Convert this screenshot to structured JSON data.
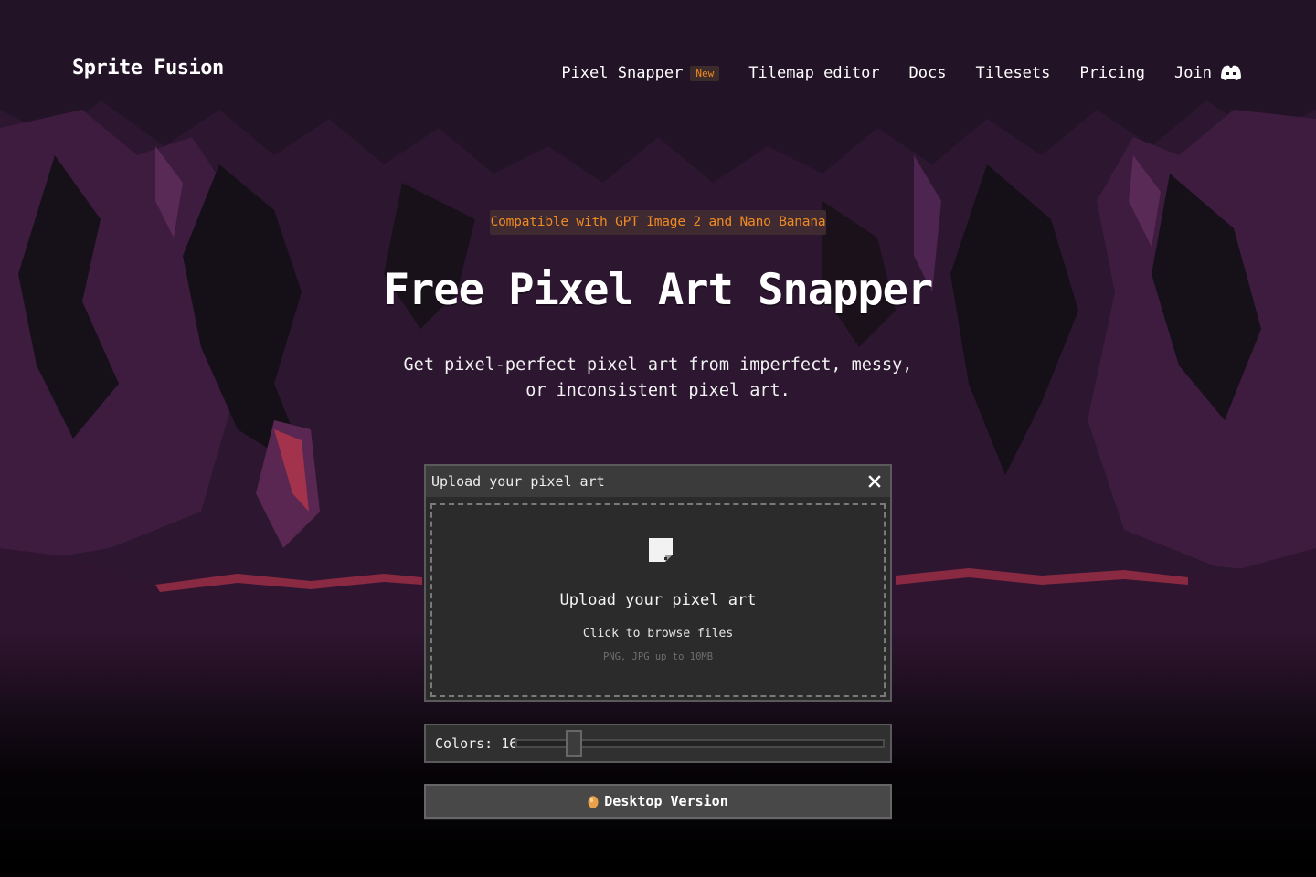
{
  "brand": {
    "name": "Sprite Fusion"
  },
  "nav": {
    "items": [
      {
        "label": "Pixel Snapper",
        "badge": "New"
      },
      {
        "label": "Tilemap editor"
      },
      {
        "label": "Docs"
      },
      {
        "label": "Tilesets"
      },
      {
        "label": "Pricing"
      },
      {
        "label": "Join",
        "icon": "discord-icon"
      }
    ]
  },
  "hero": {
    "badge": "Compatible with GPT Image 2 and Nano Banana",
    "title": "Free Pixel Art Snapper",
    "subtitle": "Get pixel-perfect pixel art from imperfect, messy, or inconsistent pixel art."
  },
  "upload_panel": {
    "header": "Upload your pixel art",
    "close_icon": "close-icon",
    "dropzone_icon": "file-icon",
    "dropzone_title": "Upload your pixel art",
    "dropzone_hint": "Click to browse files",
    "dropzone_note": "PNG, JPG up to 10MB"
  },
  "colors": {
    "label": "Colors: 16",
    "value": 16
  },
  "desktop_button": {
    "label": "Desktop Version",
    "icon": "egg-icon"
  },
  "theme": {
    "accent": "#f08a24",
    "bg_dark": "#1c0f1f",
    "cave_purple": "#4a1f48",
    "lava": "#8a2a42",
    "panel": "#2b2b2b"
  }
}
